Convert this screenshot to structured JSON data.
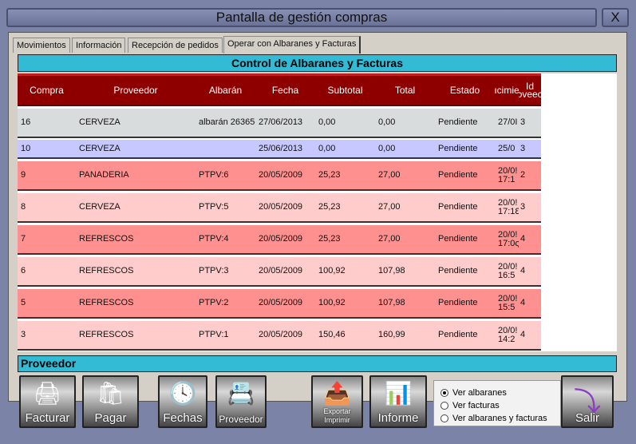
{
  "window": {
    "title": "Pantalla de gestión compras",
    "close_label": "X"
  },
  "tabs": [
    {
      "label": "Movimientos"
    },
    {
      "label": "Información"
    },
    {
      "label": "Recepción de pedidos"
    },
    {
      "label": "Operar con Albaranes y Facturas",
      "active": true
    }
  ],
  "section_title": "Control de Albaranes y Facturas",
  "table": {
    "columns": [
      "Compra",
      "Proveedor",
      "Albarán",
      "Fecha",
      "Subtotal",
      "Total",
      "Estado",
      "ıcimie",
      "Id\nɔveec"
    ],
    "rows": [
      [
        "16",
        "CERVEZA",
        "albarán 26365",
        "27/06/2013",
        "0,00",
        "0,00",
        "Pendiente",
        "27/0I",
        "3"
      ],
      [
        "10",
        "CERVEZA",
        "",
        "25/06/2013",
        "0,00",
        "0,00",
        "Pendiente",
        "25/0",
        "3"
      ],
      [
        "9",
        "PANADERIA",
        "PTPV:6",
        "20/05/2009",
        "25,23",
        "27,00",
        "Pendiente",
        "20/0!\n17:1",
        "2"
      ],
      [
        "8",
        "CERVEZA",
        "PTPV:5",
        "20/05/2009",
        "25,23",
        "27,00",
        "Pendiente",
        "20/0!\n17:1Ɛ",
        "3"
      ],
      [
        "7",
        "REFRESCOS",
        "PTPV:4",
        "20/05/2009",
        "25,23",
        "27,00",
        "Pendiente",
        "20/0!\n17:0ς",
        "4"
      ],
      [
        "6",
        "REFRESCOS",
        "PTPV:3",
        "20/05/2009",
        "100,92",
        "107,98",
        "Pendiente",
        "20/0!\n16:5",
        "4"
      ],
      [
        "5",
        "REFRESCOS",
        "PTPV:2",
        "20/05/2009",
        "100,92",
        "107,98",
        "Pendiente",
        "20/0!\n15:5",
        "4"
      ],
      [
        "3",
        "REFRESCOS",
        "PTPV:1",
        "20/05/2009",
        "150,46",
        "160,99",
        "Pendiente",
        "20/0!\n14:2",
        "4"
      ]
    ],
    "row_colors": [
      "#d8dcdc",
      "#c6c8ff",
      "#ff9090",
      "#ffcccc",
      "#ff9090",
      "#ffcccc",
      "#ff9090",
      "#ffcccc"
    ]
  },
  "proveedor_label": "Proveedor",
  "buttons": [
    {
      "label": "Facturar",
      "icon": "printer-icon"
    },
    {
      "label": "Pagar",
      "icon": "shopping-bag-icon"
    },
    {
      "label": "Fechas",
      "icon": "clock-icon"
    },
    {
      "label": "Proveedor",
      "icon": "contact-card-icon"
    },
    {
      "label": "Exportar\nImprimir",
      "icon": "export-print-icon"
    },
    {
      "label": "Informe",
      "icon": "bar-chart-icon"
    },
    {
      "label": "Salir",
      "icon": "exit-arrow-icon"
    }
  ],
  "view_options": [
    {
      "label": "Ver albaranes",
      "selected": true
    },
    {
      "label": "Ver facturas",
      "selected": false
    },
    {
      "label": "Ver albaranes y facturas",
      "selected": false
    }
  ]
}
